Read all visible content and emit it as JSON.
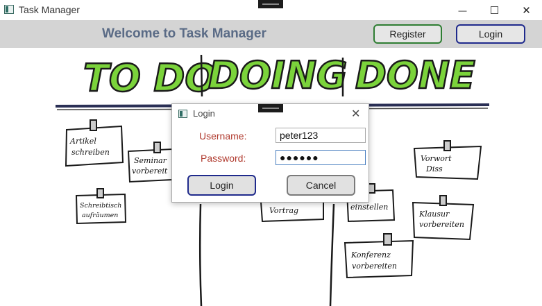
{
  "window": {
    "title": "Task Manager",
    "minimize_glyph": "—",
    "maximize_glyph": "☐",
    "close_glyph": "✕"
  },
  "header": {
    "welcome": "Welcome to Task Manager",
    "register_label": "Register",
    "login_label": "Login"
  },
  "board": {
    "columns": [
      "TO DO",
      "DOING",
      "DONE"
    ],
    "notes": [
      "Artikel schreiben",
      "Seminar vorbereiten",
      "Schreibtisch aufräumen",
      "Vortrag",
      "einstellen",
      "Vorwort Diss",
      "Klausur vorbereiten",
      "Konferenz vorbereiten"
    ],
    "marker_color": "#7bd33b"
  },
  "dialog": {
    "title": "Login",
    "username_label": "Username:",
    "username_value": "peter123",
    "password_label": "Password:",
    "password_value": "●●●●●●",
    "login_button": "Login",
    "cancel_button": "Cancel"
  },
  "icons": [
    "app-icon",
    "minimize-icon",
    "maximize-icon",
    "close-icon"
  ]
}
